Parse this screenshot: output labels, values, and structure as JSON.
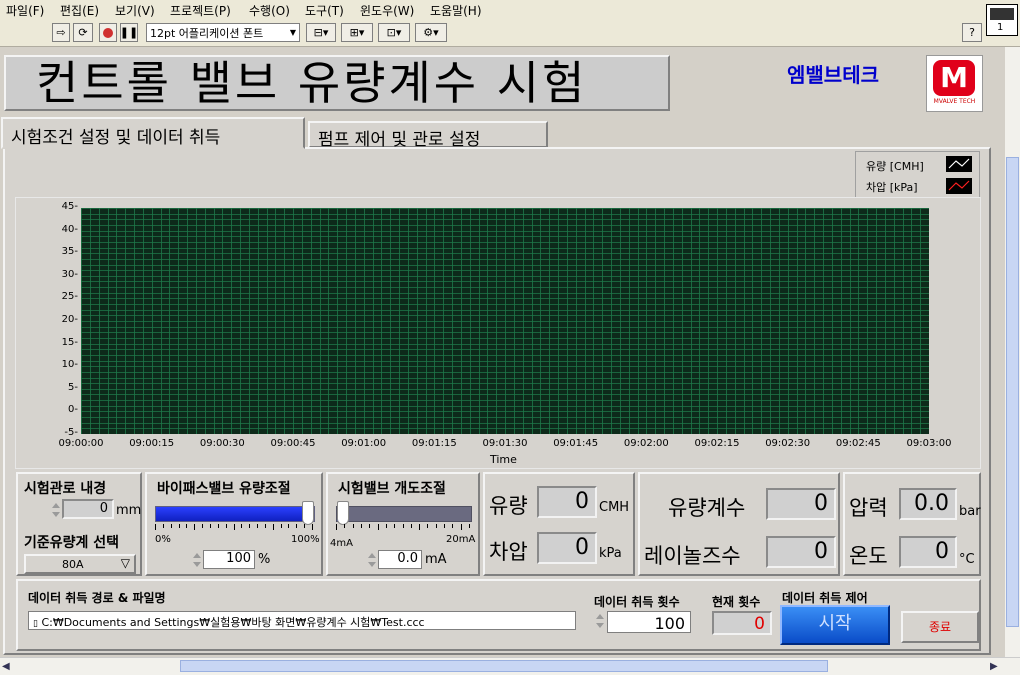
{
  "menu": [
    "파일(F)",
    "편집(E)",
    "보기(V)",
    "프로젝트(P)",
    "수행(O)",
    "도구(T)",
    "윈도우(W)",
    "도움말(H)"
  ],
  "toolbar": {
    "font_select": "12pt 어플리케이션 폰트",
    "help": "?"
  },
  "corner_icon_text": "1",
  "title": "컨트롤 밸브 유량계수 시험",
  "brand": {
    "name": "엠밸브테크",
    "logo_letter": "M",
    "logo_sub": "MVALVE TECH",
    "colors": {
      "primary": "#0000cc",
      "logo": "#e0001a"
    }
  },
  "tabs": [
    {
      "label": "시험조건 설정 및 데이터 취득",
      "active": true
    },
    {
      "label": "펌프 제어 및 관로 설정",
      "active": false
    }
  ],
  "legend": [
    {
      "label": "유량 [CMH]",
      "color": "#ffffff"
    },
    {
      "label": "차압 [kPa]",
      "color": "#ff2020"
    }
  ],
  "chart_data": {
    "type": "line",
    "xlabel": "Time",
    "ylabel": "",
    "x_ticks": [
      "09:00:00",
      "09:00:15",
      "09:00:30",
      "09:00:45",
      "09:01:00",
      "09:01:15",
      "09:01:30",
      "09:01:45",
      "09:02:00",
      "09:02:15",
      "09:02:30",
      "09:02:45",
      "09:03:00"
    ],
    "y_ticks": [
      "45",
      "40",
      "35",
      "30",
      "25",
      "20",
      "15",
      "10",
      "5",
      "0",
      "-5"
    ],
    "ylim": [
      -5,
      45
    ],
    "grid": true,
    "series": [
      {
        "name": "유량 [CMH]",
        "values": []
      },
      {
        "name": "차압 [kPa]",
        "values": []
      }
    ]
  },
  "pipe": {
    "diameter_label": "시험관로 내경",
    "diameter_value": "0",
    "diameter_unit": "mm",
    "flowmeter_label": "기준유량계 선택",
    "flowmeter_value": "80A"
  },
  "bypass": {
    "label": "바이패스밸브 유량조절",
    "min": "0%",
    "max": "100%",
    "value": "100",
    "unit": "%",
    "fraction": 1.0
  },
  "test_valve": {
    "label": "시험밸브 개도조절",
    "min": "4mA",
    "max": "20mA",
    "value": "0.0",
    "unit": "mA",
    "fraction": 0.0
  },
  "readouts": {
    "flow_label": "유량",
    "flow_value": "0",
    "flow_unit": "CMH",
    "dp_label": "차압",
    "dp_value": "0",
    "dp_unit": "kPa",
    "cv_label": "유량계수",
    "cv_value": "0",
    "re_label": "레이놀즈수",
    "re_value": "0",
    "pressure_label": "압력",
    "pressure_value": "0.0",
    "pressure_unit": "bar",
    "temp_label": "온도",
    "temp_value": "0",
    "temp_unit": "°C"
  },
  "acquisition": {
    "path_label": "데이터 취득 경로 & 파일명",
    "path_value": "C:₩Documents and Settings₩실험용₩바탕 화면₩유량계수 시험₩Test.ccc",
    "count_label": "데이터 취득 횟수",
    "count_value": "100",
    "current_label": "현재 횟수",
    "current_value": "0",
    "control_label": "데이터 취득 제어",
    "start": "시작",
    "stop": "종료"
  }
}
